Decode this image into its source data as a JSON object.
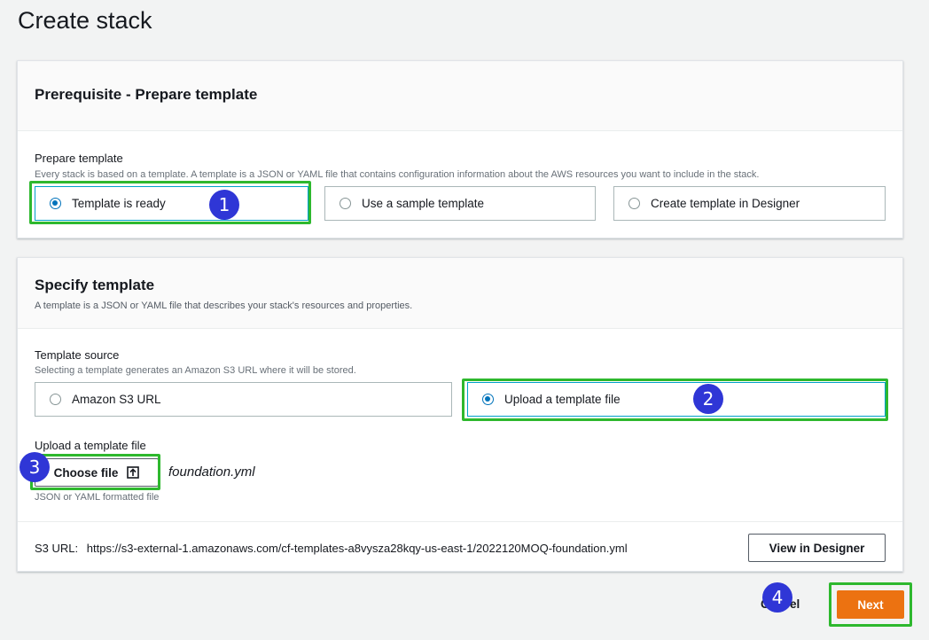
{
  "page": {
    "title": "Create stack"
  },
  "prerequisite": {
    "title": "Prerequisite - Prepare template",
    "field_label": "Prepare template",
    "field_desc": "Every stack is based on a template. A template is a JSON or YAML file that contains configuration information about the AWS resources you want to include in the stack.",
    "options": [
      {
        "label": "Template is ready",
        "selected": true
      },
      {
        "label": "Use a sample template",
        "selected": false
      },
      {
        "label": "Create template in Designer",
        "selected": false
      }
    ]
  },
  "specify": {
    "title": "Specify template",
    "desc": "A template is a JSON or YAML file that describes your stack's resources and properties.",
    "source_label": "Template source",
    "source_desc": "Selecting a template generates an Amazon S3 URL where it will be stored.",
    "source_options": [
      {
        "label": "Amazon S3 URL",
        "selected": false
      },
      {
        "label": "Upload a template file",
        "selected": true
      }
    ],
    "upload_label": "Upload a template file",
    "choose_file_label": "Choose file",
    "file_name": "foundation.yml",
    "upload_hint": "JSON or YAML formatted file",
    "s3_url_label": "S3 URL:",
    "s3_url": "https://s3-external-1.amazonaws.com/cf-templates-a8vysza28kqy-us-east-1/2022120MOQ-foundation.yml",
    "view_designer_label": "View in Designer"
  },
  "footer": {
    "cancel_label": "Cancel",
    "next_label": "Next"
  },
  "annotations": {
    "badge1": "1",
    "badge2": "2",
    "badge3": "3",
    "badge4": "4"
  },
  "colors": {
    "highlight": "#2eb82e",
    "badge": "#2f36d6",
    "primary": "#ec7211",
    "radio": "#0073bb"
  }
}
